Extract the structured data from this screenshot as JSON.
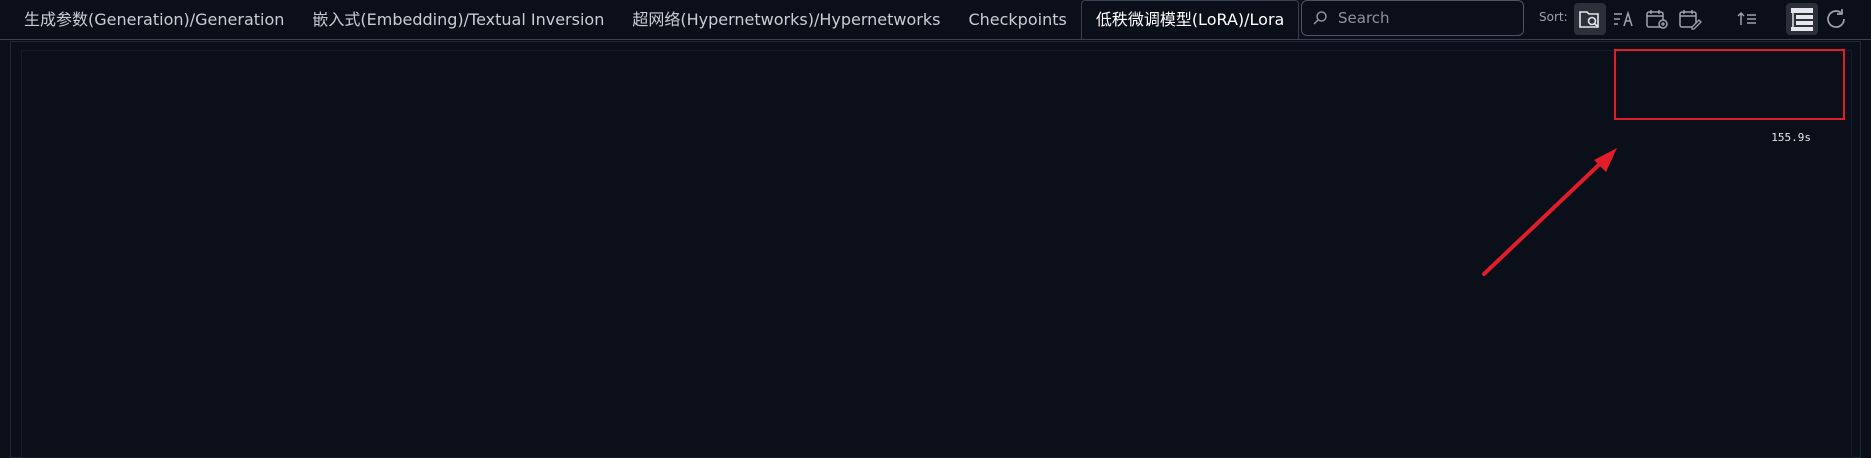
{
  "tabs": [
    {
      "label": "生成参数(Generation)/Generation",
      "active": false
    },
    {
      "label": "嵌入式(Embedding)/Textual Inversion",
      "active": false
    },
    {
      "label": "超网络(Hypernetworks)/Hypernetworks",
      "active": false
    },
    {
      "label": "Checkpoints",
      "active": false
    },
    {
      "label": "低秩微调模型(LoRA)/Lora",
      "active": true
    }
  ],
  "search": {
    "placeholder": "Search",
    "value": ""
  },
  "sort": {
    "label": "Sort:",
    "options": [
      {
        "icon": "folder-search-icon",
        "selected": true
      },
      {
        "icon": "sort-alpha-icon",
        "selected": false
      },
      {
        "icon": "calendar-add-icon",
        "selected": false
      },
      {
        "icon": "calendar-edit-icon",
        "selected": false
      }
    ],
    "direction_icon": "sort-direction-icon"
  },
  "toolbar": {
    "tree_view_icon": "tree-view-icon",
    "refresh_icon": "refresh-icon"
  },
  "status": {
    "elapsed": "155.9s"
  },
  "colors": {
    "background": "#0b0f19",
    "annotation": "#e11d2a",
    "border": "#374151"
  }
}
